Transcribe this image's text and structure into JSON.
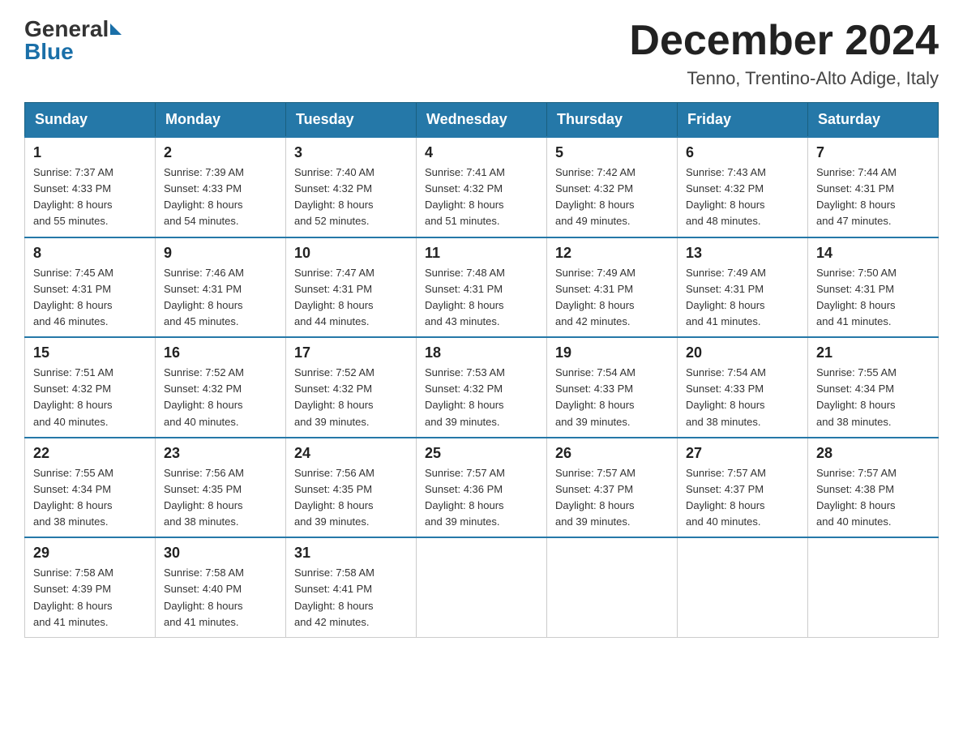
{
  "header": {
    "logo_general": "General",
    "logo_blue": "Blue",
    "month_title": "December 2024",
    "location": "Tenno, Trentino-Alto Adige, Italy"
  },
  "days_of_week": [
    "Sunday",
    "Monday",
    "Tuesday",
    "Wednesday",
    "Thursday",
    "Friday",
    "Saturday"
  ],
  "weeks": [
    [
      {
        "day": "1",
        "sunrise": "7:37 AM",
        "sunset": "4:33 PM",
        "daylight": "8 hours and 55 minutes."
      },
      {
        "day": "2",
        "sunrise": "7:39 AM",
        "sunset": "4:33 PM",
        "daylight": "8 hours and 54 minutes."
      },
      {
        "day": "3",
        "sunrise": "7:40 AM",
        "sunset": "4:32 PM",
        "daylight": "8 hours and 52 minutes."
      },
      {
        "day": "4",
        "sunrise": "7:41 AM",
        "sunset": "4:32 PM",
        "daylight": "8 hours and 51 minutes."
      },
      {
        "day": "5",
        "sunrise": "7:42 AM",
        "sunset": "4:32 PM",
        "daylight": "8 hours and 49 minutes."
      },
      {
        "day": "6",
        "sunrise": "7:43 AM",
        "sunset": "4:32 PM",
        "daylight": "8 hours and 48 minutes."
      },
      {
        "day": "7",
        "sunrise": "7:44 AM",
        "sunset": "4:31 PM",
        "daylight": "8 hours and 47 minutes."
      }
    ],
    [
      {
        "day": "8",
        "sunrise": "7:45 AM",
        "sunset": "4:31 PM",
        "daylight": "8 hours and 46 minutes."
      },
      {
        "day": "9",
        "sunrise": "7:46 AM",
        "sunset": "4:31 PM",
        "daylight": "8 hours and 45 minutes."
      },
      {
        "day": "10",
        "sunrise": "7:47 AM",
        "sunset": "4:31 PM",
        "daylight": "8 hours and 44 minutes."
      },
      {
        "day": "11",
        "sunrise": "7:48 AM",
        "sunset": "4:31 PM",
        "daylight": "8 hours and 43 minutes."
      },
      {
        "day": "12",
        "sunrise": "7:49 AM",
        "sunset": "4:31 PM",
        "daylight": "8 hours and 42 minutes."
      },
      {
        "day": "13",
        "sunrise": "7:49 AM",
        "sunset": "4:31 PM",
        "daylight": "8 hours and 41 minutes."
      },
      {
        "day": "14",
        "sunrise": "7:50 AM",
        "sunset": "4:31 PM",
        "daylight": "8 hours and 41 minutes."
      }
    ],
    [
      {
        "day": "15",
        "sunrise": "7:51 AM",
        "sunset": "4:32 PM",
        "daylight": "8 hours and 40 minutes."
      },
      {
        "day": "16",
        "sunrise": "7:52 AM",
        "sunset": "4:32 PM",
        "daylight": "8 hours and 40 minutes."
      },
      {
        "day": "17",
        "sunrise": "7:52 AM",
        "sunset": "4:32 PM",
        "daylight": "8 hours and 39 minutes."
      },
      {
        "day": "18",
        "sunrise": "7:53 AM",
        "sunset": "4:32 PM",
        "daylight": "8 hours and 39 minutes."
      },
      {
        "day": "19",
        "sunrise": "7:54 AM",
        "sunset": "4:33 PM",
        "daylight": "8 hours and 39 minutes."
      },
      {
        "day": "20",
        "sunrise": "7:54 AM",
        "sunset": "4:33 PM",
        "daylight": "8 hours and 38 minutes."
      },
      {
        "day": "21",
        "sunrise": "7:55 AM",
        "sunset": "4:34 PM",
        "daylight": "8 hours and 38 minutes."
      }
    ],
    [
      {
        "day": "22",
        "sunrise": "7:55 AM",
        "sunset": "4:34 PM",
        "daylight": "8 hours and 38 minutes."
      },
      {
        "day": "23",
        "sunrise": "7:56 AM",
        "sunset": "4:35 PM",
        "daylight": "8 hours and 38 minutes."
      },
      {
        "day": "24",
        "sunrise": "7:56 AM",
        "sunset": "4:35 PM",
        "daylight": "8 hours and 39 minutes."
      },
      {
        "day": "25",
        "sunrise": "7:57 AM",
        "sunset": "4:36 PM",
        "daylight": "8 hours and 39 minutes."
      },
      {
        "day": "26",
        "sunrise": "7:57 AM",
        "sunset": "4:37 PM",
        "daylight": "8 hours and 39 minutes."
      },
      {
        "day": "27",
        "sunrise": "7:57 AM",
        "sunset": "4:37 PM",
        "daylight": "8 hours and 40 minutes."
      },
      {
        "day": "28",
        "sunrise": "7:57 AM",
        "sunset": "4:38 PM",
        "daylight": "8 hours and 40 minutes."
      }
    ],
    [
      {
        "day": "29",
        "sunrise": "7:58 AM",
        "sunset": "4:39 PM",
        "daylight": "8 hours and 41 minutes."
      },
      {
        "day": "30",
        "sunrise": "7:58 AM",
        "sunset": "4:40 PM",
        "daylight": "8 hours and 41 minutes."
      },
      {
        "day": "31",
        "sunrise": "7:58 AM",
        "sunset": "4:41 PM",
        "daylight": "8 hours and 42 minutes."
      },
      null,
      null,
      null,
      null
    ]
  ],
  "labels": {
    "sunrise": "Sunrise:",
    "sunset": "Sunset:",
    "daylight": "Daylight:"
  }
}
